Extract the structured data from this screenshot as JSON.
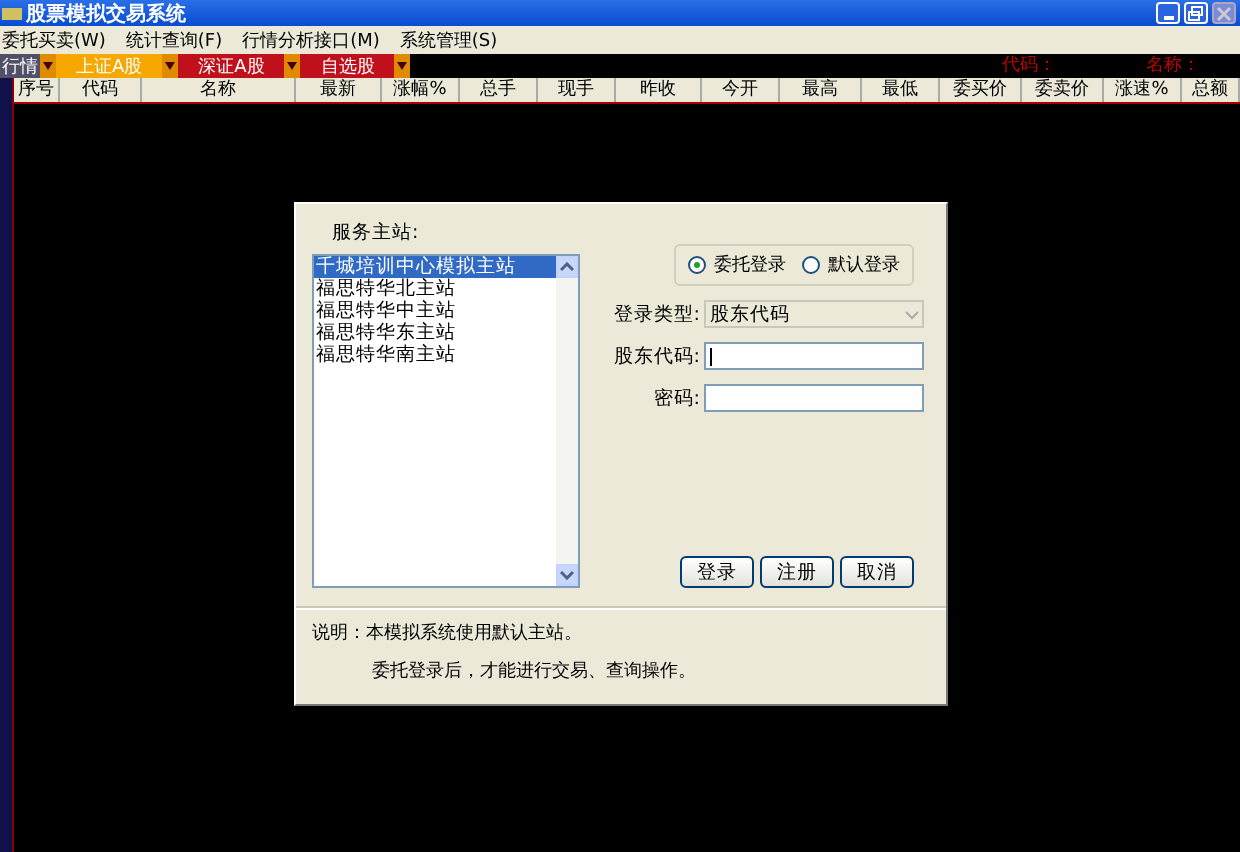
{
  "window": {
    "title": "股票模拟交易系统"
  },
  "menu": [
    "委托买卖(W)",
    "统计查询(F)",
    "行情分析接口(M)",
    "系统管理(S)"
  ],
  "market_tabs": [
    {
      "label": "行情",
      "selected": false,
      "kind": "cut"
    },
    {
      "label": "上证A股",
      "selected": true,
      "kind": "tab"
    },
    {
      "label": "深证A股",
      "selected": false,
      "kind": "tab"
    },
    {
      "label": "自选股",
      "selected": false,
      "kind": "tab"
    }
  ],
  "quote_info": [
    "代码：",
    "名称："
  ],
  "table": {
    "columns": [
      "序号",
      "代码",
      "名称",
      "最新",
      "涨幅%",
      "总手",
      "现手",
      "昨收",
      "今开",
      "最高",
      "最低",
      "委买价",
      "委卖价",
      "涨速%",
      "总额"
    ]
  },
  "dialog": {
    "server_label": "服务主站:",
    "servers": [
      {
        "label": "千城培训中心模拟主站",
        "selected": true
      },
      {
        "label": "福思特华北主站",
        "selected": false
      },
      {
        "label": "福思特华中主站",
        "selected": false
      },
      {
        "label": "福思特华东主站",
        "selected": false
      },
      {
        "label": "福思特华南主站",
        "selected": false
      }
    ],
    "login_modes": [
      {
        "label": "委托登录",
        "selected": true
      },
      {
        "label": "默认登录",
        "selected": false
      }
    ],
    "login_type": {
      "label": "登录类型:",
      "value": "股东代码",
      "disabled": true
    },
    "account": {
      "label": "股东代码:"
    },
    "password": {
      "label": "密码:"
    },
    "buttons": [
      "登录",
      "注册",
      "取消"
    ],
    "notes": [
      "说明：本模拟系统使用默认主站。",
      "委托登录后，才能进行交易、查询操作。"
    ]
  }
}
